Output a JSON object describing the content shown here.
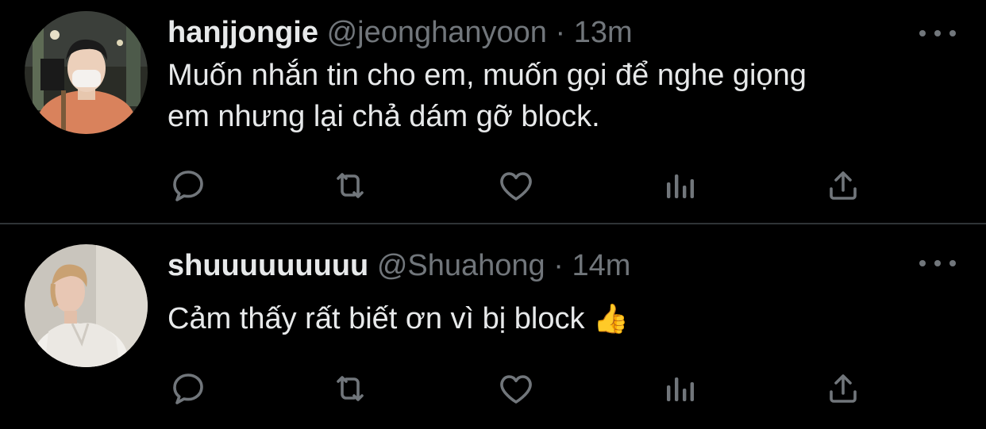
{
  "tweets": [
    {
      "display_name": "hanjjongie",
      "handle": "@jeonghanyoon",
      "separator": "·",
      "time": "13m",
      "text_lines": [
        "Muốn nhắn tin cho em, muốn gọi để nghe giọng",
        "em nhưng lại chả dám gỡ block."
      ]
    },
    {
      "display_name": "shuuuuuuuuu",
      "handle": "@Shuahong",
      "separator": "·",
      "time": "14m",
      "text_lines": [
        "Cảm thấy rất biết ơn vì bị block"
      ],
      "emoji": "👍"
    }
  ],
  "icons": {
    "reply": "reply-icon",
    "retweet": "retweet-icon",
    "like": "heart-icon",
    "views": "views-chart-icon",
    "share": "share-icon",
    "more": "more-dots-icon"
  },
  "colors": {
    "background": "#000000",
    "primary_text": "#e7e9ea",
    "secondary_text": "#71767b",
    "divider": "#2f3336"
  }
}
